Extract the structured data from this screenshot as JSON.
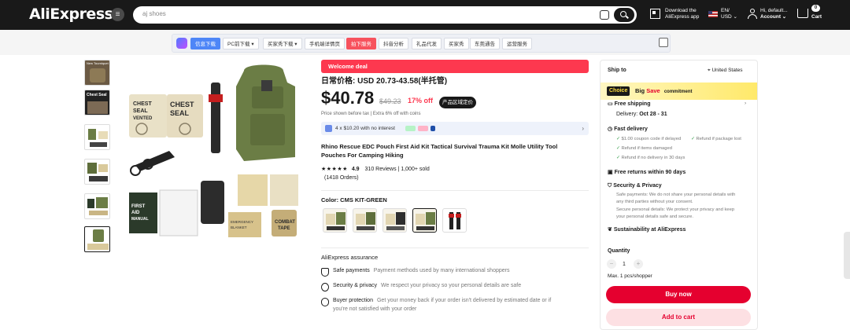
{
  "header": {
    "logo": "AliExpress",
    "search_value": "aj shoes",
    "download_line1": "Download the",
    "download_line2": "AliExpress app",
    "lang_line1": "EN/",
    "lang_line2": "USD",
    "account_line1": "Hi, default...",
    "account_line2": "Account",
    "cart_count": "0",
    "cart_label": "Cart"
  },
  "toolbar": {
    "buttons": [
      "信息下载",
      "PC前下载",
      "买家秀下载",
      "手机端详情页",
      "拍下服务",
      "抖音分析",
      "礼品代发",
      "买家秀",
      "东莞通告",
      "运营服务"
    ]
  },
  "product": {
    "welcome": "Welcome deal",
    "price_range": "日常价格: USD 20.73-43.58(半托管)",
    "price": "$40.78",
    "original_price": "$49.23",
    "discount": "17% off",
    "region_badge": "产品区域定价",
    "price_note": "Price shown before tax  |  Extra 6% off with coins",
    "installment": "4 x $10.20 with no interest",
    "title": "Rhino Rescue EDC Pouch First Aid Kit Tactical Survival Trauma Kit Molle Utility Tool Pouches For Camping Hiking",
    "rating_value": "4.9",
    "reviews": "310 Reviews",
    "sold": "1,000+ sold",
    "orders": "(1418 Orders)",
    "color_label": "Color: CMS KIT-GREEN",
    "assurance_heading": "AliExpress assurance",
    "assurances": [
      {
        "title": "Safe payments",
        "text": "Payment methods used by many international shoppers"
      },
      {
        "title": "Security & privacy",
        "text": "We respect your privacy so your personal details are safe"
      },
      {
        "title": "Buyer protection",
        "text": "Get your money back if your order isn't delivered by estimated date or if"
      },
      {
        "title": "",
        "text": "you're not satisfied with your order"
      }
    ],
    "thumb_labels": [
      "New Tourniquet",
      "Chest Seal"
    ],
    "image_labels": [
      "CHEST SEAL VENTED",
      "CHEST SEAL",
      "FIRST AID MANUAL",
      "COMBAT TAPE",
      "EMERGENCY BLANKET"
    ]
  },
  "panel": {
    "ship_to_label": "Ship to",
    "ship_to": "United States",
    "choice": "Choice",
    "big_save_1": "Big",
    "big_save_2": "Save",
    "commitment": "commitment",
    "free_shipping": "Free shipping",
    "delivery_label": "Delivery:",
    "delivery_date": "Oct 28 - 31",
    "fast_delivery": "Fast delivery",
    "fd_1": "$1.00 coupon code if delayed",
    "fd_2": "Refund if package lost",
    "fd_3": "Refund if items damaged",
    "fd_4": "Refund if no delivery in 30 days",
    "free_returns": "Free returns within 90 days",
    "security": "Security & Privacy",
    "sec_1": "Safe payments: We do not share your personal details with",
    "sec_2": "any third parties without your consent.",
    "sec_3": "Secure personal details: We protect your privacy and keep",
    "sec_4": "your personal details safe and secure.",
    "sustainability": "Sustainability at AliExpress",
    "quantity_label": "Quantity",
    "quantity_value": "1",
    "max_note": "Max. 1 pcs/shopper",
    "buy_now": "Buy now",
    "add_to_cart": "Add to cart"
  },
  "colors": {
    "header_bg": "#191919",
    "accent_red": "#e5002f",
    "welcome_red": "#fd384f",
    "choice_yellow": "#ffde3f"
  }
}
